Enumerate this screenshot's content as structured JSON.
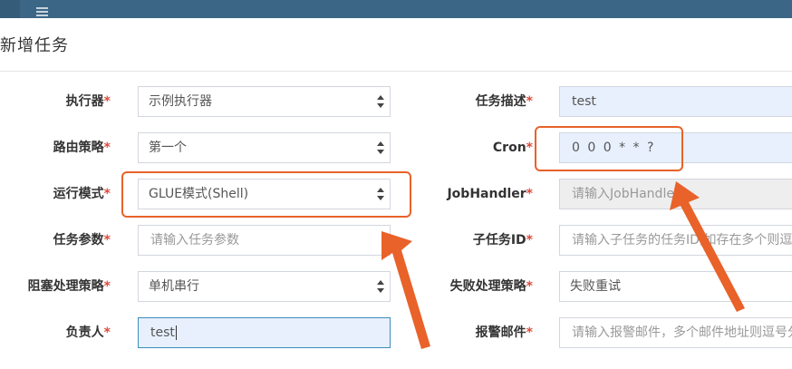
{
  "modal": {
    "title": "新增任务"
  },
  "form": {
    "left": [
      {
        "label": "执行器",
        "required": "*",
        "type": "select",
        "value": "示例执行器"
      },
      {
        "label": "路由策略",
        "required": "*",
        "type": "select",
        "value": "第一个"
      },
      {
        "label": "运行模式",
        "required": "*",
        "type": "select",
        "value": "GLUE模式(Shell)"
      },
      {
        "label": "任务参数",
        "required": "*",
        "type": "input",
        "value": "",
        "placeholder": "请输入任务参数"
      },
      {
        "label": "阻塞处理策略",
        "required": "*",
        "type": "select",
        "value": "单机串行"
      },
      {
        "label": "负责人",
        "required": "*",
        "type": "input",
        "value": "test",
        "placeholder": ""
      }
    ],
    "right": [
      {
        "label": "任务描述",
        "required": "*",
        "type": "input",
        "value": "test",
        "placeholder": ""
      },
      {
        "label": "Cron",
        "required": "*",
        "type": "input",
        "value": "0 0 0 * * ?",
        "placeholder": ""
      },
      {
        "label": "JobHandler",
        "required": "*",
        "type": "input",
        "value": "",
        "placeholder": "请输入JobHandler"
      },
      {
        "label": "子任务ID",
        "required": "*",
        "type": "input",
        "value": "",
        "placeholder": "请输入子任务的任务ID,如存在多个则逗号分隔"
      },
      {
        "label": "失败处理策略",
        "required": "*",
        "type": "select",
        "value": "失败重试"
      },
      {
        "label": "报警邮件",
        "required": "*",
        "type": "input",
        "value": "",
        "placeholder": "请输入报警邮件，多个邮件地址则逗号分隔"
      }
    ]
  },
  "annotations": {
    "color": "#e8622a"
  },
  "icons": {
    "menu": "hamburger-icon",
    "select": "select-arrows-icon"
  }
}
